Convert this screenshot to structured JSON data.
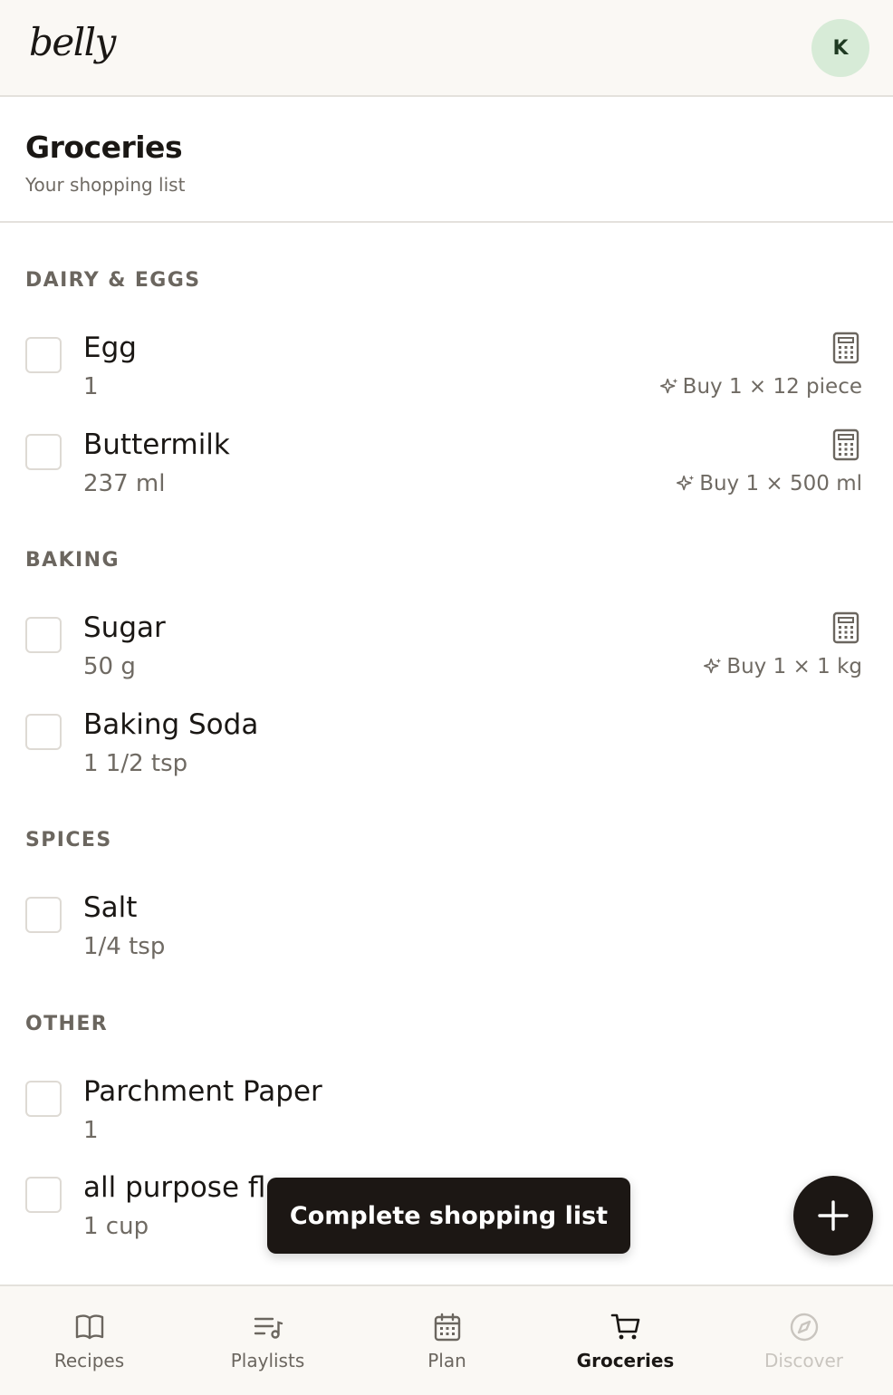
{
  "app": {
    "logo": "belly",
    "avatar_initial": "K"
  },
  "header": {
    "title": "Groceries",
    "subtitle": "Your shopping list"
  },
  "sections": [
    {
      "title": "DAIRY & EGGS",
      "items": [
        {
          "name": "Egg",
          "qty": "1",
          "buy_hint": "Buy 1 × 12 piece",
          "has_calculator": true
        },
        {
          "name": "Buttermilk",
          "qty": "237 ml",
          "buy_hint": "Buy 1 × 500 ml",
          "has_calculator": true
        }
      ]
    },
    {
      "title": "BAKING",
      "items": [
        {
          "name": "Sugar",
          "qty": "50 g",
          "buy_hint": "Buy 1 × 1 kg",
          "has_calculator": true
        },
        {
          "name": "Baking Soda",
          "qty": "1 1/2 tsp",
          "buy_hint": "",
          "has_calculator": false
        }
      ]
    },
    {
      "title": "SPICES",
      "items": [
        {
          "name": "Salt",
          "qty": "1/4 tsp",
          "buy_hint": "",
          "has_calculator": false
        }
      ]
    },
    {
      "title": "OTHER",
      "items": [
        {
          "name": "Parchment Paper",
          "qty": "1",
          "buy_hint": "",
          "has_calculator": false
        },
        {
          "name": "all purpose flour",
          "qty": "1 cup",
          "buy_hint": "",
          "has_calculator": false
        }
      ]
    }
  ],
  "actions": {
    "complete_label": "Complete shopping list",
    "add_icon": "plus-icon"
  },
  "nav": {
    "items": [
      {
        "label": "Recipes",
        "icon": "book-icon",
        "state": "normal"
      },
      {
        "label": "Playlists",
        "icon": "playlist-icon",
        "state": "normal"
      },
      {
        "label": "Plan",
        "icon": "calendar-icon",
        "state": "normal"
      },
      {
        "label": "Groceries",
        "icon": "cart-icon",
        "state": "active"
      },
      {
        "label": "Discover",
        "icon": "compass-icon",
        "state": "disabled"
      }
    ]
  },
  "colors": {
    "accent": "#1c1714",
    "avatar_bg": "#d7ebd7",
    "muted_text": "#6f6a63",
    "surface": "#faf8f4"
  }
}
